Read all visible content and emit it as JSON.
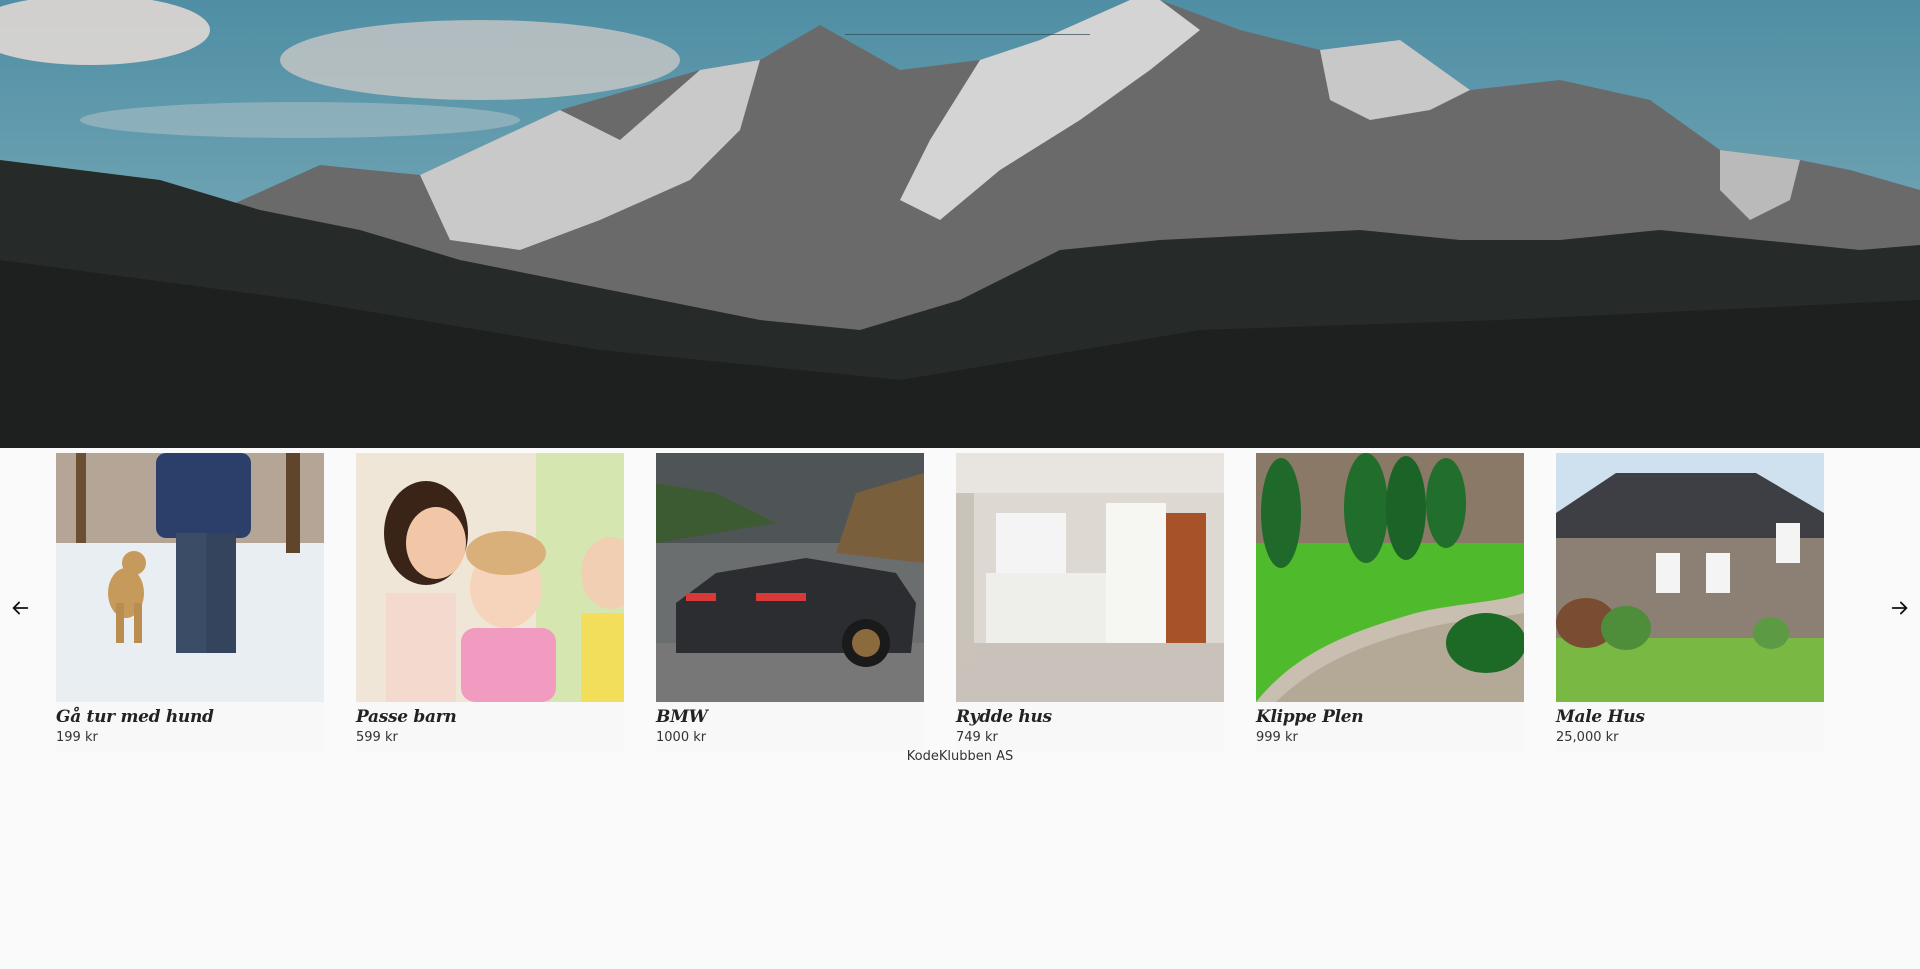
{
  "hero": {
    "image": "mountain-landscape"
  },
  "carousel": {
    "prev_icon": "arrow-left-icon",
    "next_icon": "arrow-right-icon",
    "items": [
      {
        "title": "Gå tur med hund",
        "price": "199 kr",
        "image": "person-walking-dog-in-snow"
      },
      {
        "title": "Passe barn",
        "price": "599 kr",
        "image": "woman-with-children"
      },
      {
        "title": "BMW",
        "price": "1000 kr",
        "image": "dark-bmw-car"
      },
      {
        "title": "Rydde hus",
        "price": "749 kr",
        "image": "kitchen-interior"
      },
      {
        "title": "Klippe Plen",
        "price": "999 kr",
        "image": "lawn-garden"
      },
      {
        "title": "Male Hus",
        "price": "25,000 kr",
        "image": "grey-house"
      }
    ]
  },
  "footer": {
    "text": "KodeKlubben AS"
  }
}
